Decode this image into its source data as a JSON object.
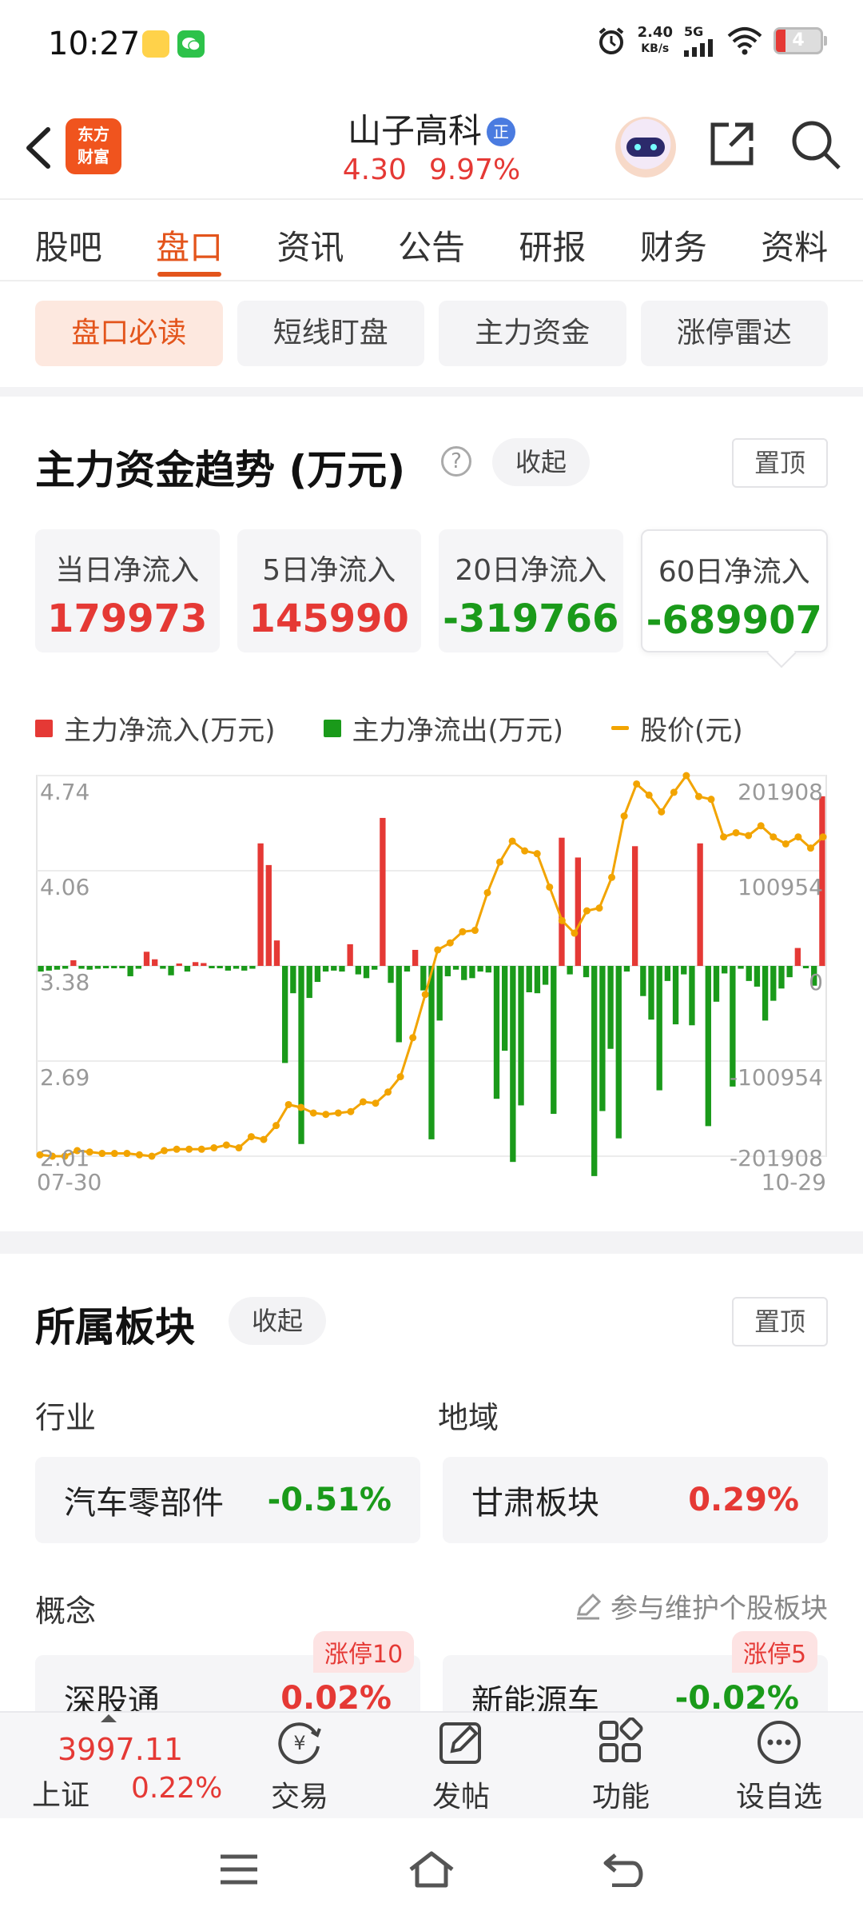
{
  "status_bar": {
    "time": "10:27",
    "net_speed_value": "2.40",
    "net_speed_unit": "KB/s",
    "signal_label": "5G",
    "battery": "4"
  },
  "header": {
    "logo_text": "东方\n财富",
    "stock_name": "山子高科",
    "badge": "正",
    "price": "4.30",
    "change_pct": "9.97%"
  },
  "tabs": [
    "股吧",
    "盘口",
    "资讯",
    "公告",
    "研报",
    "财务",
    "资料"
  ],
  "active_tab": "盘口",
  "subtabs": [
    "盘口必读",
    "短线盯盘",
    "主力资金",
    "涨停雷达"
  ],
  "fund_section": {
    "title": "主力资金趋势 (万元)",
    "help_icon": "?",
    "collapse_label": "收起",
    "pin_label": "置顶",
    "cards": [
      {
        "label": "当日净流入",
        "value": "179973",
        "color": "red"
      },
      {
        "label": "5日净流入",
        "value": "145990",
        "color": "red"
      },
      {
        "label": "20日净流入",
        "value": "-319766",
        "color": "green"
      },
      {
        "label": "60日净流入",
        "value": "-689907",
        "color": "green"
      }
    ],
    "legend": {
      "inflow": "主力净流入(万元)",
      "outflow": "主力净流出(万元)",
      "price": "股价(元)"
    }
  },
  "chart_data": {
    "type": "bar",
    "series": [
      {
        "name": "主力净流入(万元) / 主力净流出(万元)",
        "values": [
          -6000,
          -5000,
          -4000,
          -3000,
          6000,
          -3000,
          -4000,
          -3000,
          -2000,
          -2000,
          -2000,
          -11000,
          -3000,
          15000,
          7000,
          -3000,
          -10000,
          2000,
          -6000,
          4000,
          3000,
          -2000,
          -2000,
          -5000,
          -3000,
          -5000,
          -3000,
          130000,
          107000,
          27000,
          -103000,
          -29000,
          -189000,
          -34000,
          -17000,
          -6000,
          -5000,
          -6000,
          23000,
          -9000,
          -13000,
          -4000,
          157000,
          -18000,
          -81000,
          -6000,
          17000,
          -26000,
          -184000,
          -58000,
          -11000,
          -4000,
          -15000,
          -13000,
          -6000,
          -7000,
          -141000,
          -90000,
          -208000,
          -148000,
          -28000,
          -29000,
          -20000,
          -157000,
          136000,
          -9000,
          115000,
          -12000,
          -223000,
          -154000,
          -88000,
          -183000,
          -6000,
          127000,
          -32000,
          -57000,
          -132000,
          -16000,
          -62000,
          -9000,
          -63000,
          130000,
          -170000,
          -38000,
          -8000,
          -128000,
          -3000,
          -16000,
          -22000,
          -58000,
          -37000,
          -24000,
          -12000,
          19000,
          -2000,
          -21000,
          179973
        ]
      },
      {
        "name": "股价(元)",
        "values": [
          2.02,
          2.01,
          2.01,
          2.05,
          2.04,
          2.03,
          2.03,
          2.03,
          2.02,
          2.01,
          2.05,
          2.06,
          2.06,
          2.06,
          2.07,
          2.09,
          2.07,
          2.15,
          2.13,
          2.23,
          2.38,
          2.36,
          2.32,
          2.31,
          2.32,
          2.33,
          2.4,
          2.39,
          2.47,
          2.58,
          2.86,
          3.17,
          3.49,
          3.54,
          3.62,
          3.63,
          3.9,
          4.12,
          4.27,
          4.2,
          4.18,
          3.94,
          3.7,
          3.61,
          3.77,
          3.79,
          4.01,
          4.45,
          4.68,
          4.6,
          4.48,
          4.62,
          4.74,
          4.59,
          4.57,
          4.3,
          4.33,
          4.31,
          4.38,
          4.3,
          4.25,
          4.3,
          4.22,
          4.3
        ]
      }
    ],
    "x_labels": [
      "07-30",
      "10-29"
    ],
    "y_left_ticks": [
      "4.74",
      "4.06",
      "3.38",
      "2.69",
      "2.01"
    ],
    "y_right_ticks": [
      "201908",
      "100954",
      "0",
      "-100954",
      "-201908"
    ],
    "y_left_range": [
      2.01,
      4.74
    ],
    "y_right_range": [
      -201908,
      201908
    ],
    "colors": {
      "inflow": "#e53935",
      "outflow": "#1a9a1a",
      "price": "#f2a400"
    }
  },
  "sector_section": {
    "title": "所属板块",
    "collapse_label": "收起",
    "pin_label": "置顶",
    "industry_label": "行业",
    "region_label": "地域",
    "industry": {
      "name": "汽车零部件",
      "pct": "-0.51%"
    },
    "region": {
      "name": "甘肃板块",
      "pct": "0.29%"
    },
    "concept_label": "概念",
    "maintain_label": "参与维护个股板块",
    "concepts": [
      {
        "name": "深股通",
        "pct": "0.02%",
        "tag": "涨停10"
      },
      {
        "name": "新能源车",
        "pct": "-0.02%",
        "tag": "涨停5"
      }
    ]
  },
  "bottom_bar": {
    "index_value": "3997.11",
    "index_name": "上证",
    "index_change": "0.22%",
    "items": [
      "交易",
      "发帖",
      "功能",
      "设自选"
    ]
  }
}
